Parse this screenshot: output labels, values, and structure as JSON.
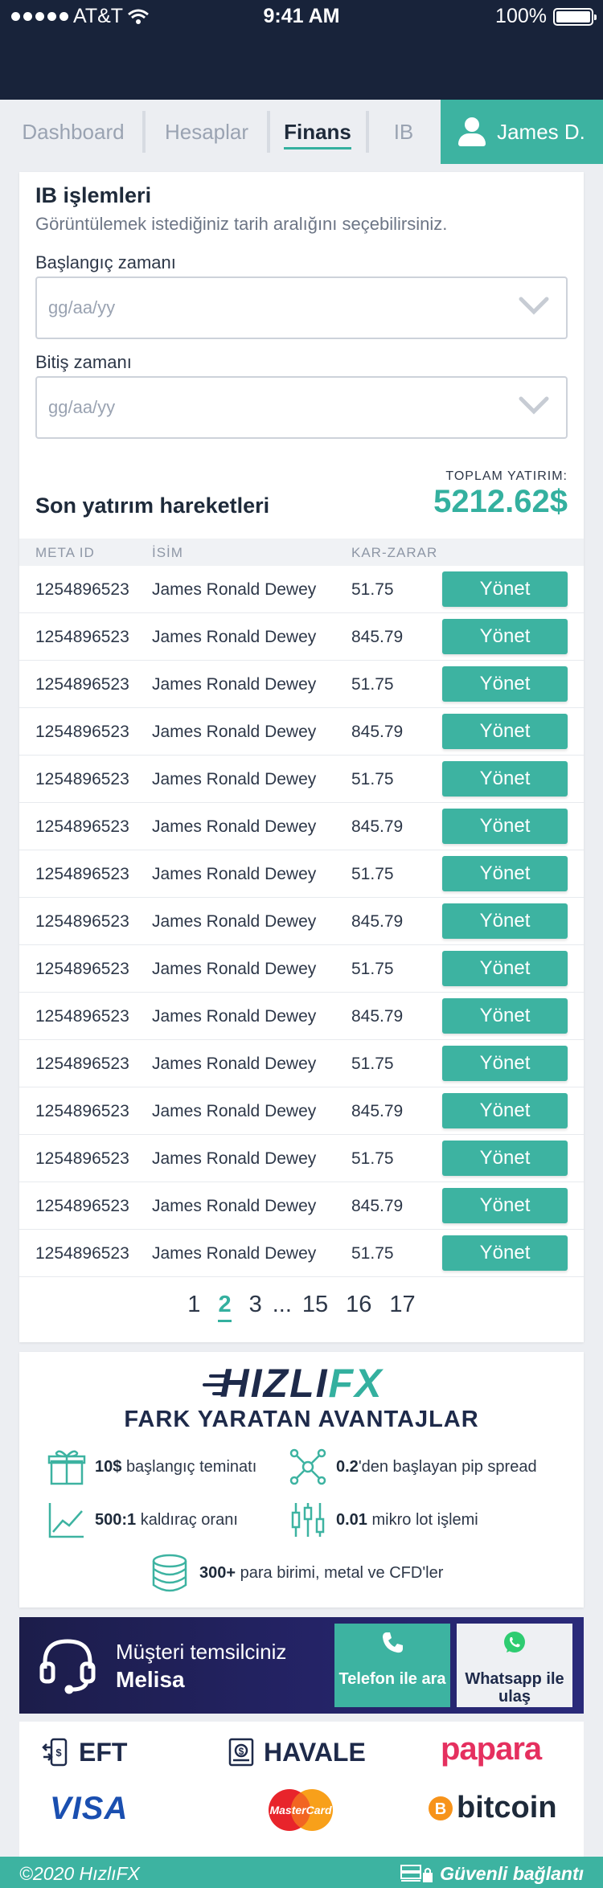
{
  "status_bar": {
    "carrier": "AT&T",
    "time": "9:41 AM",
    "battery": "100%"
  },
  "nav": {
    "tabs": [
      {
        "label": "Dashboard"
      },
      {
        "label": "Hesaplar"
      },
      {
        "label": "Finans",
        "active": true
      },
      {
        "label": "IB"
      }
    ],
    "user_name": "James D."
  },
  "ib": {
    "title": "IB işlemleri",
    "subtitle": "Görüntülemek istediğiniz tarih aralığını seçebilirsiniz.",
    "start_label": "Başlangıç zamanı",
    "start_placeholder": "gg/aa/yy",
    "end_label": "Bitiş zamanı",
    "end_placeholder": "gg/aa/yy"
  },
  "investments": {
    "title": "Son yatırım hareketleri",
    "total_label": "TOPLAM YATIRIM:",
    "total_value": "5212.62$",
    "columns": [
      "META ID",
      "İSİM",
      "KAR-ZARAR"
    ],
    "action_label": "Yönet",
    "rows": [
      {
        "id": "1254896523",
        "name": "James Ronald Dewey",
        "pl": "51.75"
      },
      {
        "id": "1254896523",
        "name": "James Ronald Dewey",
        "pl": "845.79"
      },
      {
        "id": "1254896523",
        "name": "James Ronald Dewey",
        "pl": "51.75"
      },
      {
        "id": "1254896523",
        "name": "James Ronald Dewey",
        "pl": "845.79"
      },
      {
        "id": "1254896523",
        "name": "James Ronald Dewey",
        "pl": "51.75"
      },
      {
        "id": "1254896523",
        "name": "James Ronald Dewey",
        "pl": "845.79"
      },
      {
        "id": "1254896523",
        "name": "James Ronald Dewey",
        "pl": "51.75"
      },
      {
        "id": "1254896523",
        "name": "James Ronald Dewey",
        "pl": "845.79"
      },
      {
        "id": "1254896523",
        "name": "James Ronald Dewey",
        "pl": "51.75"
      },
      {
        "id": "1254896523",
        "name": "James Ronald Dewey",
        "pl": "845.79"
      },
      {
        "id": "1254896523",
        "name": "James Ronald Dewey",
        "pl": "51.75"
      },
      {
        "id": "1254896523",
        "name": "James Ronald Dewey",
        "pl": "845.79"
      },
      {
        "id": "1254896523",
        "name": "James Ronald Dewey",
        "pl": "51.75"
      },
      {
        "id": "1254896523",
        "name": "James Ronald Dewey",
        "pl": "845.79"
      },
      {
        "id": "1254896523",
        "name": "James Ronald Dewey",
        "pl": "51.75"
      }
    ]
  },
  "pagination": {
    "pages": [
      "1",
      "2",
      "3",
      "...",
      "15",
      "16",
      "17"
    ],
    "current": "2"
  },
  "advantages": {
    "logo_main": "HIZLI",
    "logo_accent": "FX",
    "title": "FARK YARATAN AVANTAJLAR",
    "items": [
      {
        "bold": "10$",
        "text": "başlangıç teminatı",
        "icon": "gift-icon"
      },
      {
        "bold": "0.2",
        "text": "'den başlayan pip spread",
        "icon": "network-icon"
      },
      {
        "bold": "500:1",
        "text": "kaldıraç oranı",
        "icon": "chart-line-icon"
      },
      {
        "bold": "0.01",
        "text": "mikro lot işlemi",
        "icon": "candlestick-icon"
      },
      {
        "bold": "300+",
        "text": "para birimi, metal ve CFD'ler",
        "icon": "coins-icon"
      }
    ]
  },
  "support": {
    "line1": "Müşteri temsilciniz",
    "line2": "Melisa",
    "phone_button": "Telefon ile ara",
    "whatsapp_button": "Whatsapp ile ulaş"
  },
  "payments": [
    "EFT",
    "HAVALE",
    "papara",
    "VISA",
    "MasterCard",
    "bitcoin"
  ],
  "footer": {
    "copyright": "©2020 HızlıFX",
    "secure": "Güvenli bağlantı"
  },
  "colors": {
    "accent": "#3db3a1",
    "navy": "#18233a",
    "banner": "#25246a"
  }
}
